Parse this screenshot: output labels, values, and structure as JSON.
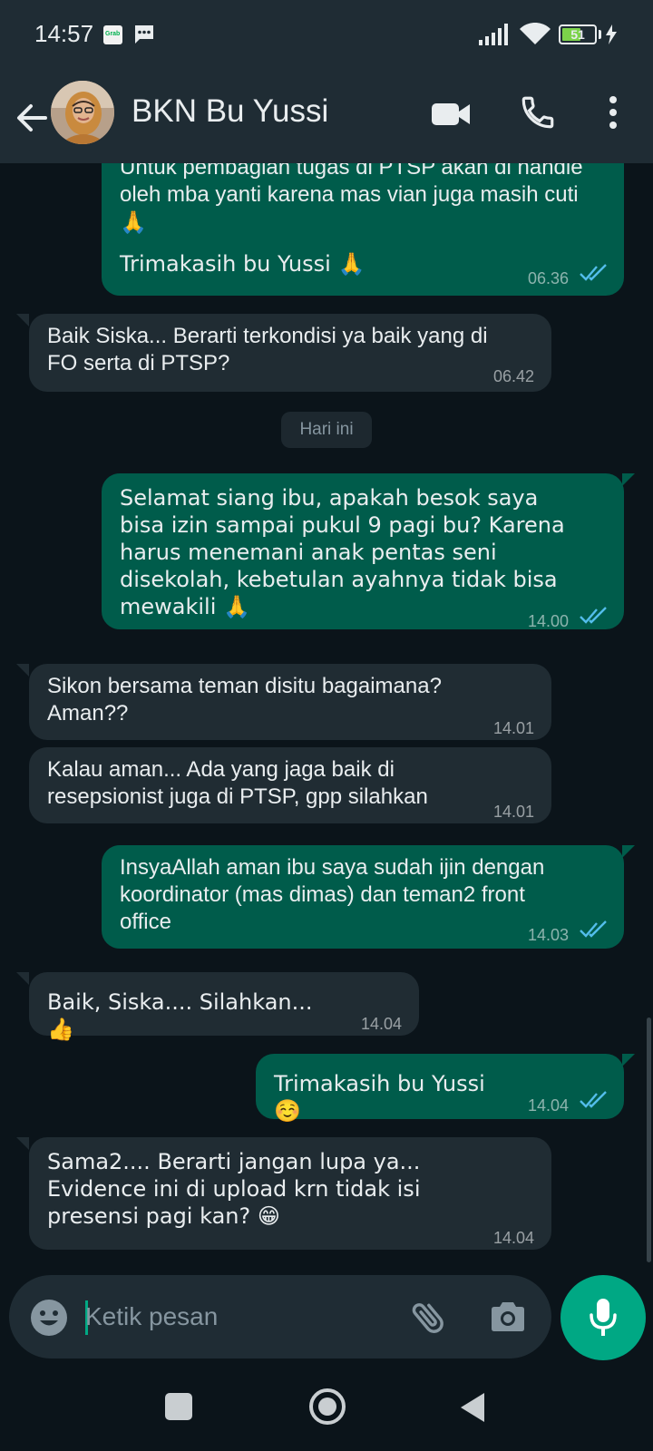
{
  "status_bar": {
    "time": "14:57",
    "app_badge": "Grab",
    "battery": "51"
  },
  "header": {
    "contact_name": "BKN Bu Yussi"
  },
  "messages": [
    {
      "direction": "out",
      "text_lines": [
        "Untuk pembagian tugas di PTSP akan di handle",
        "oleh mba yanti karena mas vian juga masih cuti",
        "🙏"
      ],
      "text2": "Trimakasih bu Yussi 🙏",
      "time": "06.36",
      "read": true
    },
    {
      "direction": "in",
      "text": "Baik Siska... Berarti terkondisi ya baik yang di FO serta di PTSP?",
      "time": "06.42"
    },
    {
      "direction": "out",
      "text": "Selamat siang ibu, apakah besok saya bisa izin sampai pukul 9 pagi bu? Karena harus menemani anak pentas seni disekolah, kebetulan ayahnya tidak bisa mewakili 🙏",
      "time": "14.00",
      "read": true
    },
    {
      "direction": "in",
      "text": "Sikon bersama teman disitu bagaimana? Aman??",
      "time": "14.01"
    },
    {
      "direction": "in",
      "text": "Kalau aman... Ada yang jaga baik di resepsionist juga di PTSP, gpp silahkan",
      "time": "14.01"
    },
    {
      "direction": "out",
      "text": "InsyaAllah aman ibu saya sudah ijin dengan koordinator (mas dimas) dan teman2 front office",
      "time": "14.03",
      "read": true
    },
    {
      "direction": "in",
      "text": "Baik, Siska.... Silahkan... 👍",
      "time": "14.04"
    },
    {
      "direction": "out",
      "text": "Trimakasih bu Yussi☺️",
      "time": "14.04",
      "read": true
    },
    {
      "direction": "in",
      "text": "Sama2.... Berarti jangan lupa ya... Evidence ini di upload krn tidak isi presensi pagi kan? 😁",
      "time": "14.04"
    }
  ],
  "date_separator": "Hari ini",
  "input": {
    "placeholder": "Ketik pesan"
  },
  "colors": {
    "outgoing_bubble": "#005c4b",
    "incoming_bubble": "#202c33",
    "background": "#0b141a",
    "header": "#1f2c34",
    "accent": "#00a884",
    "read_ticks": "#53bdeb"
  },
  "icons": [
    "back-arrow-icon",
    "video-call-icon",
    "phone-icon",
    "more-options-icon",
    "emoji-icon",
    "attach-icon",
    "camera-icon",
    "mic-icon",
    "double-tick-icon"
  ]
}
